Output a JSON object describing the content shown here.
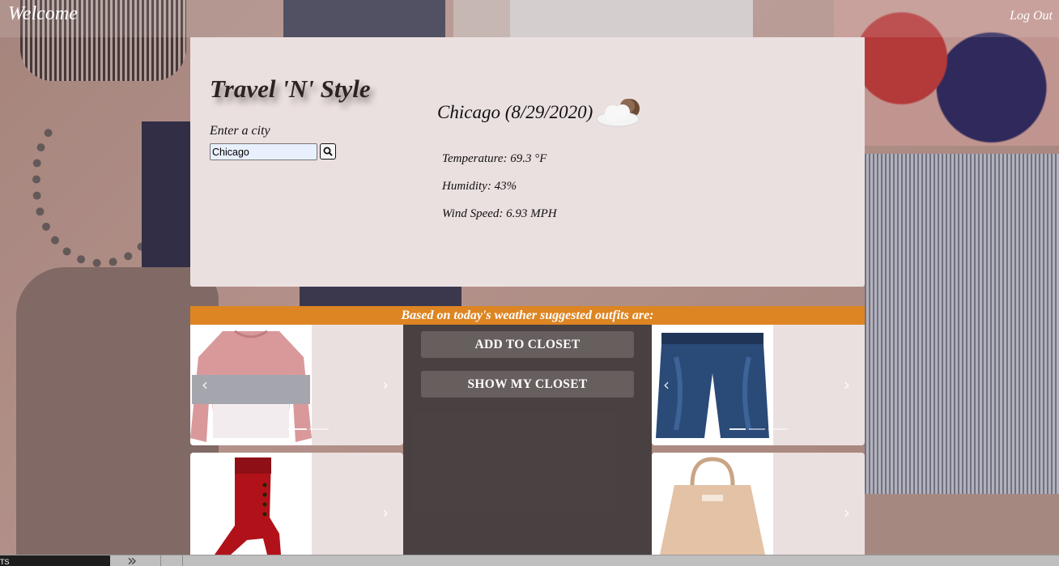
{
  "header": {
    "welcome": "Welcome",
    "logout": "Log Out"
  },
  "app": {
    "title": "Travel 'N' Style",
    "city_label": "Enter a city",
    "city_value": "Chicago"
  },
  "weather": {
    "title": "Chicago (8/29/2020)",
    "icon": "partly-cloudy-night-icon",
    "temperature": "Temperature: 69.3 °F",
    "humidity": "Humidity: 43%",
    "wind": "Wind Speed: 6.93 MPH"
  },
  "suggestions": {
    "banner": "Based on today's weather suggested outfits are:",
    "add_to_closet": "ADD TO CLOSET",
    "show_my_closet": "SHOW MY CLOSET",
    "items": [
      {
        "name": "sweater",
        "icon": "sweater-image"
      },
      {
        "name": "jeans",
        "icon": "jeans-image"
      },
      {
        "name": "boots",
        "icon": "boot-image"
      },
      {
        "name": "handbag",
        "icon": "handbag-image"
      }
    ]
  },
  "bottom": {
    "left_text": "TS"
  },
  "colors": {
    "banner": "#dd8522",
    "card": "#ebe0e0"
  }
}
